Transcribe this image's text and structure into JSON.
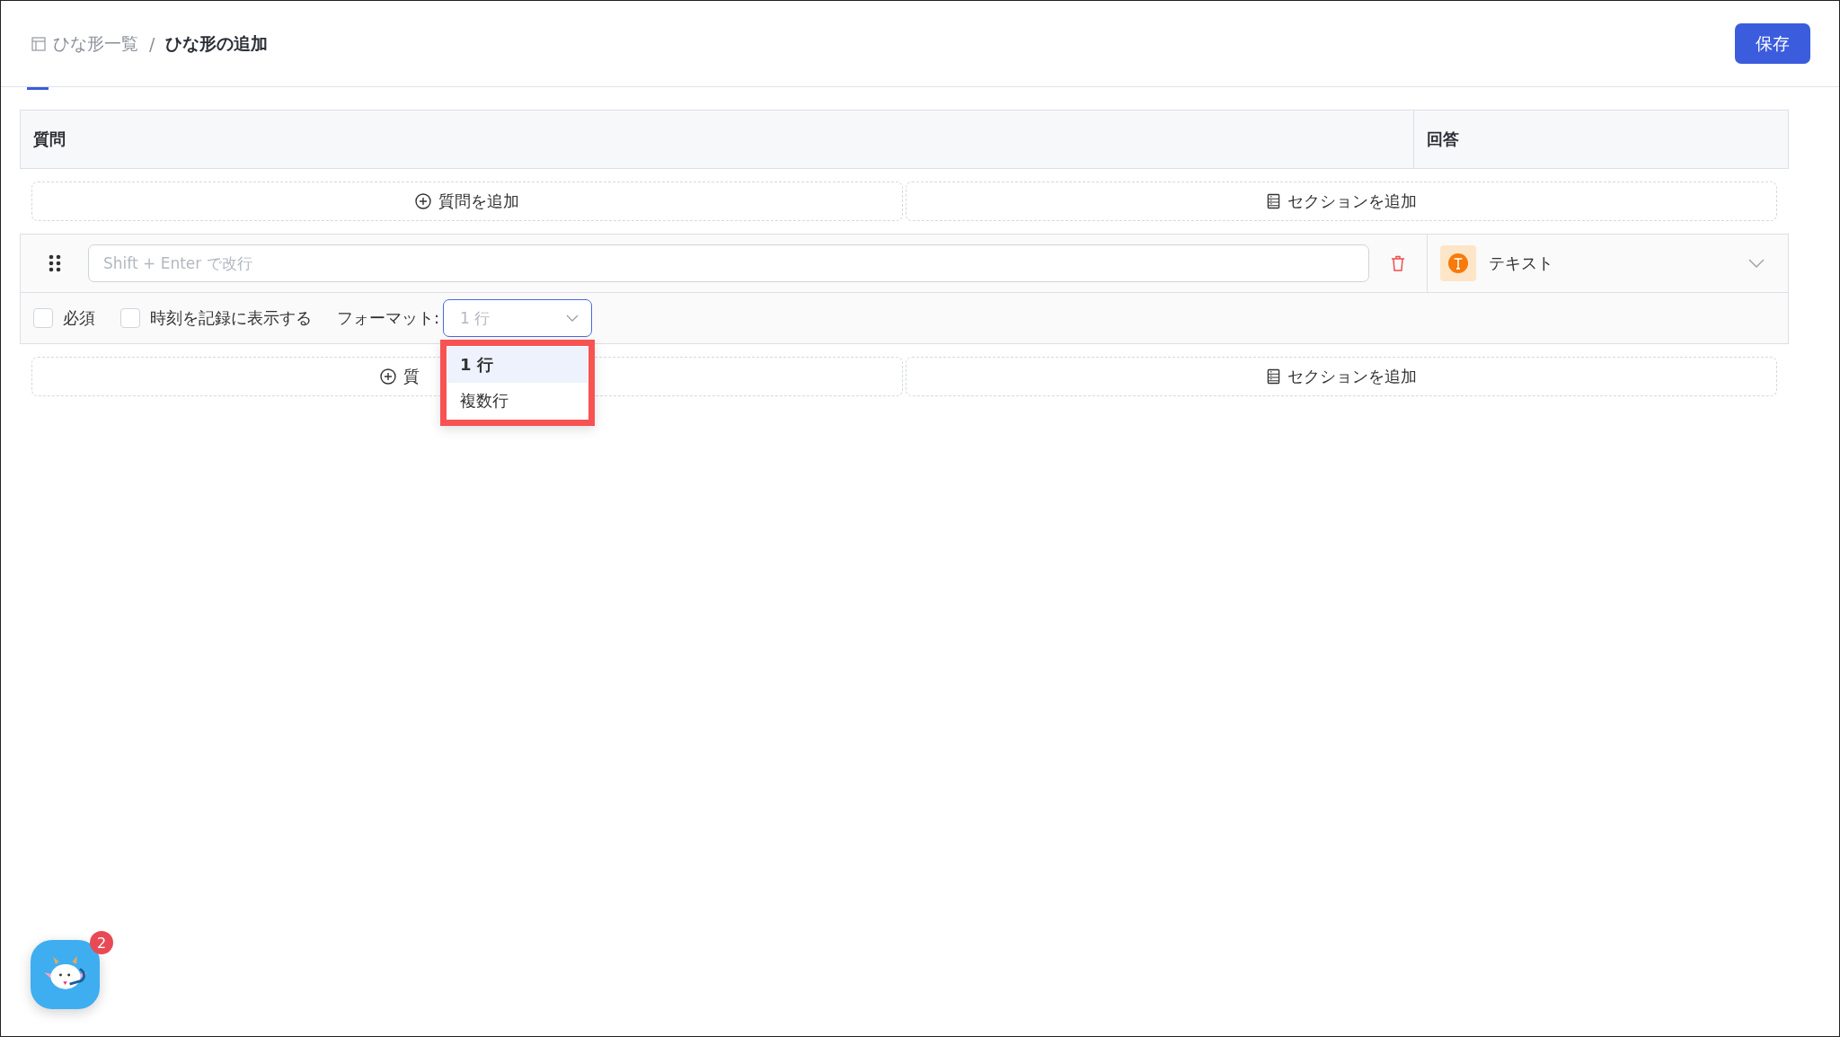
{
  "breadcrumb": {
    "parent": "ひな形一覧",
    "separator": "/",
    "current": "ひな形の追加"
  },
  "save_button": "保存",
  "table": {
    "columns": [
      "質問",
      "回答"
    ]
  },
  "add_rows": [
    {
      "add_question": "質問を追加",
      "add_section": "セクションを追加"
    },
    {
      "add_question": "質",
      "add_section": "セクションを追加"
    }
  ],
  "question": {
    "placeholder": "Shift + Enter で改行",
    "answer_type": "テキスト",
    "options": [
      {
        "label": "必須",
        "checked": false
      },
      {
        "label": "時刻を記録に表示する",
        "checked": false
      }
    ],
    "format_label": "フォーマット:",
    "format_value": "1 行",
    "format_open": true,
    "format_options": [
      {
        "label": "1 行",
        "selected": true
      },
      {
        "label": "複数行",
        "selected": false
      }
    ]
  },
  "chat_badge": "2"
}
